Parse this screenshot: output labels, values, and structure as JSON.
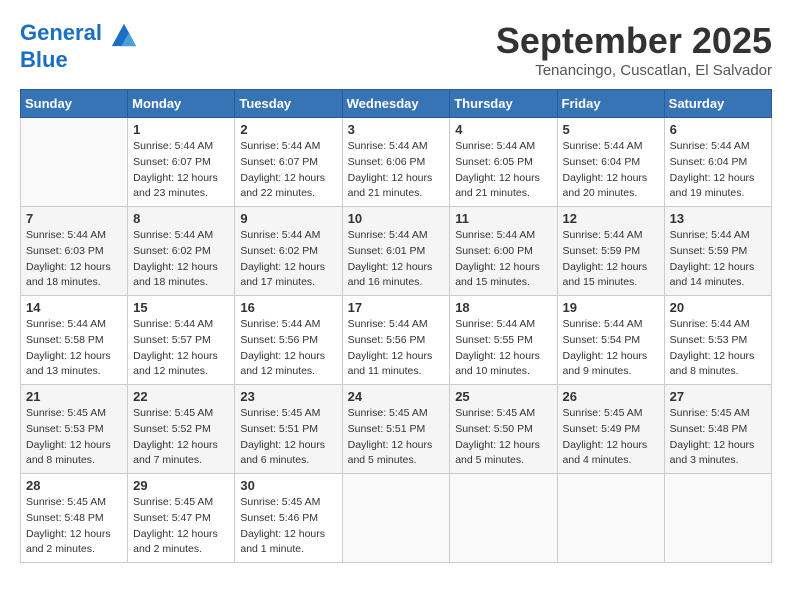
{
  "logo": {
    "line1": "General",
    "line2": "Blue"
  },
  "title": "September 2025",
  "location": "Tenancingo, Cuscatlan, El Salvador",
  "days_of_week": [
    "Sunday",
    "Monday",
    "Tuesday",
    "Wednesday",
    "Thursday",
    "Friday",
    "Saturday"
  ],
  "weeks": [
    [
      {
        "day": "",
        "info": ""
      },
      {
        "day": "1",
        "info": "Sunrise: 5:44 AM\nSunset: 6:07 PM\nDaylight: 12 hours\nand 23 minutes."
      },
      {
        "day": "2",
        "info": "Sunrise: 5:44 AM\nSunset: 6:07 PM\nDaylight: 12 hours\nand 22 minutes."
      },
      {
        "day": "3",
        "info": "Sunrise: 5:44 AM\nSunset: 6:06 PM\nDaylight: 12 hours\nand 21 minutes."
      },
      {
        "day": "4",
        "info": "Sunrise: 5:44 AM\nSunset: 6:05 PM\nDaylight: 12 hours\nand 21 minutes."
      },
      {
        "day": "5",
        "info": "Sunrise: 5:44 AM\nSunset: 6:04 PM\nDaylight: 12 hours\nand 20 minutes."
      },
      {
        "day": "6",
        "info": "Sunrise: 5:44 AM\nSunset: 6:04 PM\nDaylight: 12 hours\nand 19 minutes."
      }
    ],
    [
      {
        "day": "7",
        "info": "Sunrise: 5:44 AM\nSunset: 6:03 PM\nDaylight: 12 hours\nand 18 minutes."
      },
      {
        "day": "8",
        "info": "Sunrise: 5:44 AM\nSunset: 6:02 PM\nDaylight: 12 hours\nand 18 minutes."
      },
      {
        "day": "9",
        "info": "Sunrise: 5:44 AM\nSunset: 6:02 PM\nDaylight: 12 hours\nand 17 minutes."
      },
      {
        "day": "10",
        "info": "Sunrise: 5:44 AM\nSunset: 6:01 PM\nDaylight: 12 hours\nand 16 minutes."
      },
      {
        "day": "11",
        "info": "Sunrise: 5:44 AM\nSunset: 6:00 PM\nDaylight: 12 hours\nand 15 minutes."
      },
      {
        "day": "12",
        "info": "Sunrise: 5:44 AM\nSunset: 5:59 PM\nDaylight: 12 hours\nand 15 minutes."
      },
      {
        "day": "13",
        "info": "Sunrise: 5:44 AM\nSunset: 5:59 PM\nDaylight: 12 hours\nand 14 minutes."
      }
    ],
    [
      {
        "day": "14",
        "info": "Sunrise: 5:44 AM\nSunset: 5:58 PM\nDaylight: 12 hours\nand 13 minutes."
      },
      {
        "day": "15",
        "info": "Sunrise: 5:44 AM\nSunset: 5:57 PM\nDaylight: 12 hours\nand 12 minutes."
      },
      {
        "day": "16",
        "info": "Sunrise: 5:44 AM\nSunset: 5:56 PM\nDaylight: 12 hours\nand 12 minutes."
      },
      {
        "day": "17",
        "info": "Sunrise: 5:44 AM\nSunset: 5:56 PM\nDaylight: 12 hours\nand 11 minutes."
      },
      {
        "day": "18",
        "info": "Sunrise: 5:44 AM\nSunset: 5:55 PM\nDaylight: 12 hours\nand 10 minutes."
      },
      {
        "day": "19",
        "info": "Sunrise: 5:44 AM\nSunset: 5:54 PM\nDaylight: 12 hours\nand 9 minutes."
      },
      {
        "day": "20",
        "info": "Sunrise: 5:44 AM\nSunset: 5:53 PM\nDaylight: 12 hours\nand 8 minutes."
      }
    ],
    [
      {
        "day": "21",
        "info": "Sunrise: 5:45 AM\nSunset: 5:53 PM\nDaylight: 12 hours\nand 8 minutes."
      },
      {
        "day": "22",
        "info": "Sunrise: 5:45 AM\nSunset: 5:52 PM\nDaylight: 12 hours\nand 7 minutes."
      },
      {
        "day": "23",
        "info": "Sunrise: 5:45 AM\nSunset: 5:51 PM\nDaylight: 12 hours\nand 6 minutes."
      },
      {
        "day": "24",
        "info": "Sunrise: 5:45 AM\nSunset: 5:51 PM\nDaylight: 12 hours\nand 5 minutes."
      },
      {
        "day": "25",
        "info": "Sunrise: 5:45 AM\nSunset: 5:50 PM\nDaylight: 12 hours\nand 5 minutes."
      },
      {
        "day": "26",
        "info": "Sunrise: 5:45 AM\nSunset: 5:49 PM\nDaylight: 12 hours\nand 4 minutes."
      },
      {
        "day": "27",
        "info": "Sunrise: 5:45 AM\nSunset: 5:48 PM\nDaylight: 12 hours\nand 3 minutes."
      }
    ],
    [
      {
        "day": "28",
        "info": "Sunrise: 5:45 AM\nSunset: 5:48 PM\nDaylight: 12 hours\nand 2 minutes."
      },
      {
        "day": "29",
        "info": "Sunrise: 5:45 AM\nSunset: 5:47 PM\nDaylight: 12 hours\nand 2 minutes."
      },
      {
        "day": "30",
        "info": "Sunrise: 5:45 AM\nSunset: 5:46 PM\nDaylight: 12 hours\nand 1 minute."
      },
      {
        "day": "",
        "info": ""
      },
      {
        "day": "",
        "info": ""
      },
      {
        "day": "",
        "info": ""
      },
      {
        "day": "",
        "info": ""
      }
    ]
  ]
}
